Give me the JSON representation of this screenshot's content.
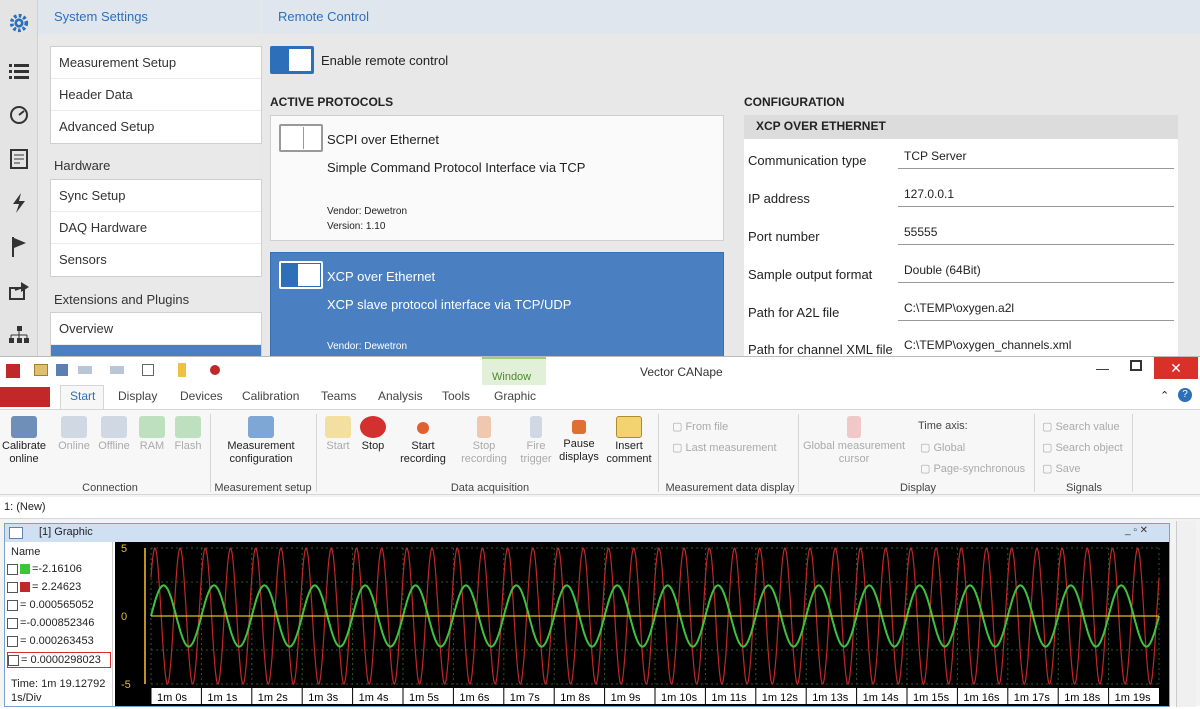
{
  "settings": {
    "header": "System Settings",
    "nav_groups": [
      {
        "title": "",
        "items": [
          "Measurement Setup",
          "Header Data",
          "Advanced Setup"
        ]
      },
      {
        "title": "Hardware",
        "items": [
          "Sync Setup",
          "DAQ Hardware",
          "Sensors"
        ]
      },
      {
        "title": "Extensions and Plugins",
        "items": [
          "Overview",
          ""
        ]
      }
    ]
  },
  "remote": {
    "header": "Remote Control",
    "enable_label": "Enable remote control",
    "active_protocols_label": "ACTIVE PROTOCOLS",
    "protocols": [
      {
        "name": "SCPI over Ethernet",
        "desc": "Simple Command Protocol Interface via TCP",
        "vendor": "Vendor:  Dewetron",
        "version": "Version:  1.10",
        "enabled": false,
        "selected": false
      },
      {
        "name": "XCP over Ethernet",
        "desc": "XCP slave protocol interface via TCP/UDP",
        "vendor": "Vendor:  Dewetron",
        "version": "",
        "enabled": true,
        "selected": true
      }
    ],
    "config_label": "CONFIGURATION",
    "config_section": "XCP OVER ETHERNET",
    "config_rows": [
      {
        "label": "Communication type",
        "value": "TCP Server"
      },
      {
        "label": "IP address",
        "value": "127.0.0.1"
      },
      {
        "label": "Port number",
        "value": "55555"
      },
      {
        "label": "Sample output format",
        "value": "Double (64Bit)"
      },
      {
        "label": "Path for A2L file",
        "value": "C:\\TEMP\\oxygen.a2l"
      },
      {
        "label": "Path for channel XML file",
        "value": "C:\\TEMP\\oxygen_channels.xml"
      }
    ]
  },
  "canape": {
    "window_title": "Vector CANape",
    "window_context_tab": "Window",
    "tabs": [
      "Start",
      "Display",
      "Devices",
      "Calibration",
      "Teams",
      "Analysis",
      "Tools",
      "Graphic"
    ],
    "active_tab": "Start",
    "ribbon": {
      "connection": {
        "label": "Connection",
        "buttons": [
          "Calibrate online",
          "Online",
          "Offline",
          "RAM",
          "Flash"
        ]
      },
      "measurement_setup": {
        "label": "Measurement setup",
        "buttons": [
          "Measurement configuration"
        ]
      },
      "data_acquisition": {
        "label": "Data acquisition",
        "buttons": [
          "Start",
          "Stop",
          "Start recording",
          "Stop recording",
          "Fire trigger",
          "Pause displays",
          "Insert comment"
        ]
      },
      "measurement_data_display": {
        "label": "Measurement data display",
        "items": [
          "From file",
          "Last measurement"
        ]
      },
      "display": {
        "label": "Display",
        "buttons": [
          "Global measurement cursor"
        ],
        "time_axis_label": "Time axis:",
        "items": [
          "Global",
          "Page-synchronous"
        ]
      },
      "signals": {
        "label": "Signals",
        "items": [
          "Search value",
          "Search object",
          "Save"
        ]
      }
    },
    "address_bar": "1: (New)",
    "graphic_window": {
      "title": "[1] Graphic",
      "name_header": "Name",
      "signals": [
        "=-2.16106",
        "= 2.24623",
        "= 0.000565052",
        "=-0.000852346",
        "= 0.000263453",
        "= 0.0000298023"
      ],
      "time_label": "Time: 1m 19.12792",
      "div_label": "1s/Div"
    },
    "chart_data": {
      "type": "line",
      "ylim": [
        -5,
        5
      ],
      "y_ticks": [
        "5",
        "0",
        "-5"
      ],
      "x_ticks": [
        "1m 0s",
        "1m 1s",
        "1m 2s",
        "1m 3s",
        "1m 4s",
        "1m 5s",
        "1m 6s",
        "1m 7s",
        "1m 8s",
        "1m 9s",
        "1m 10s",
        "1m 11s",
        "1m 12s",
        "1m 13s",
        "1m 14s",
        "1m 15s",
        "1m 16s",
        "1m 17s",
        "1m 18s",
        "1m 19s"
      ],
      "series": [
        {
          "color": "#c0282a",
          "amplitude": 5,
          "periods_per_div": 2
        },
        {
          "color": "#3fc33f",
          "amplitude": 2.25,
          "periods_per_div": 1
        },
        {
          "color": "#e0c020",
          "amplitude": 0,
          "periods_per_div": 0
        }
      ]
    }
  },
  "colors": {
    "accent": "#2d6fb8",
    "selected": "#4a7fc1"
  }
}
